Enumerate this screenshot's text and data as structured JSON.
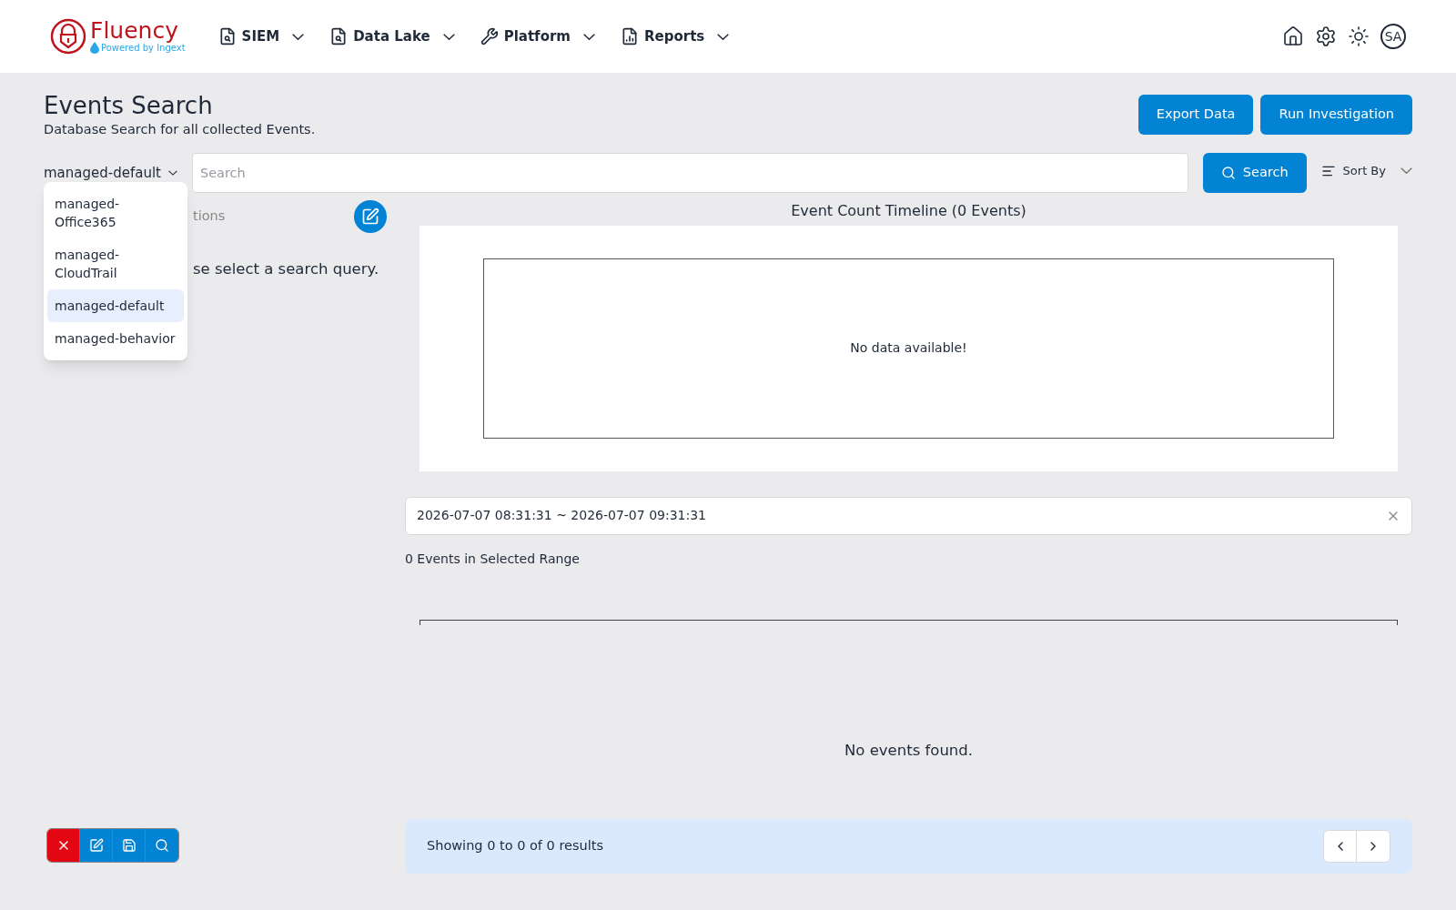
{
  "header": {
    "brand": "Fluency",
    "tagline": "Powered by Ingext",
    "nav": [
      {
        "label": "SIEM",
        "kind": "search-doc"
      },
      {
        "label": "Data Lake",
        "kind": "search-doc"
      },
      {
        "label": "Platform",
        "kind": "wrench"
      },
      {
        "label": "Reports",
        "kind": "report"
      }
    ],
    "avatar": "SA"
  },
  "page": {
    "title": "Events Search",
    "subtitle": "Database Search for all collected Events.",
    "actions": [
      "Export Data",
      "Run Investigation"
    ]
  },
  "search": {
    "source": "managed-default",
    "placeholder": "Search",
    "button": "Search",
    "sort": "Sort By"
  },
  "source_menu": [
    {
      "label": "managed-Office365",
      "selected": false
    },
    {
      "label": "managed-CloudTrail",
      "selected": false
    },
    {
      "label": "managed-default",
      "selected": true
    },
    {
      "label": "managed-behavior",
      "selected": false
    }
  ],
  "left_panel": {
    "heading": "tions",
    "message": "se select a search query."
  },
  "timeline": {
    "title": "Event Count Timeline (0 Events)",
    "empty": "No data available!"
  },
  "range": {
    "value": "2026-07-07 08:31:31 ~ 2026-07-07 09:31:31",
    "count": "0 Events in Selected Range"
  },
  "results": {
    "empty": "No events found.",
    "summary": "Showing 0 to 0 of 0 results"
  }
}
